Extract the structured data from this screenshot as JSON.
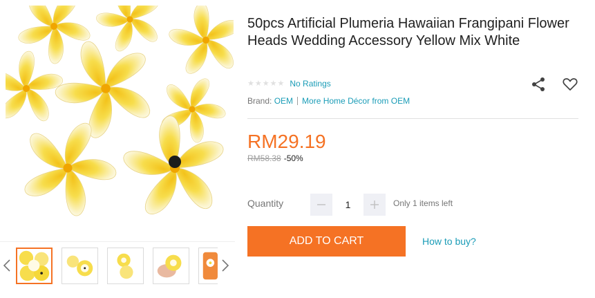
{
  "product": {
    "title": "50pcs Artificial Plumeria Hawaiian Frangipani Flower Heads Wedding Accessory Yellow Mix White",
    "rating_stars": 5,
    "ratings_text": "No Ratings",
    "brand_label": "Brand:",
    "brand_name": "OEM",
    "more_from": "More Home Décor from OEM",
    "price": "RM29.19",
    "original_price": "RM58.38",
    "discount": "-50%",
    "quantity_label": "Quantity",
    "quantity_value": "1",
    "stock_note": "Only 1 items left"
  },
  "actions": {
    "add_to_cart": "ADD TO CART",
    "how_to_buy": "How to buy?"
  },
  "gallery": {
    "thumbnail_count": 5,
    "active_index": 0
  },
  "colors": {
    "accent": "#f57224",
    "link": "#1a9cb7",
    "flower_yellow": "#f5d838",
    "flower_white": "#ffffff"
  },
  "icons": [
    "star-icon",
    "share-icon",
    "heart-icon",
    "chevron-left-icon",
    "chevron-right-icon",
    "minus-icon",
    "plus-icon"
  ]
}
